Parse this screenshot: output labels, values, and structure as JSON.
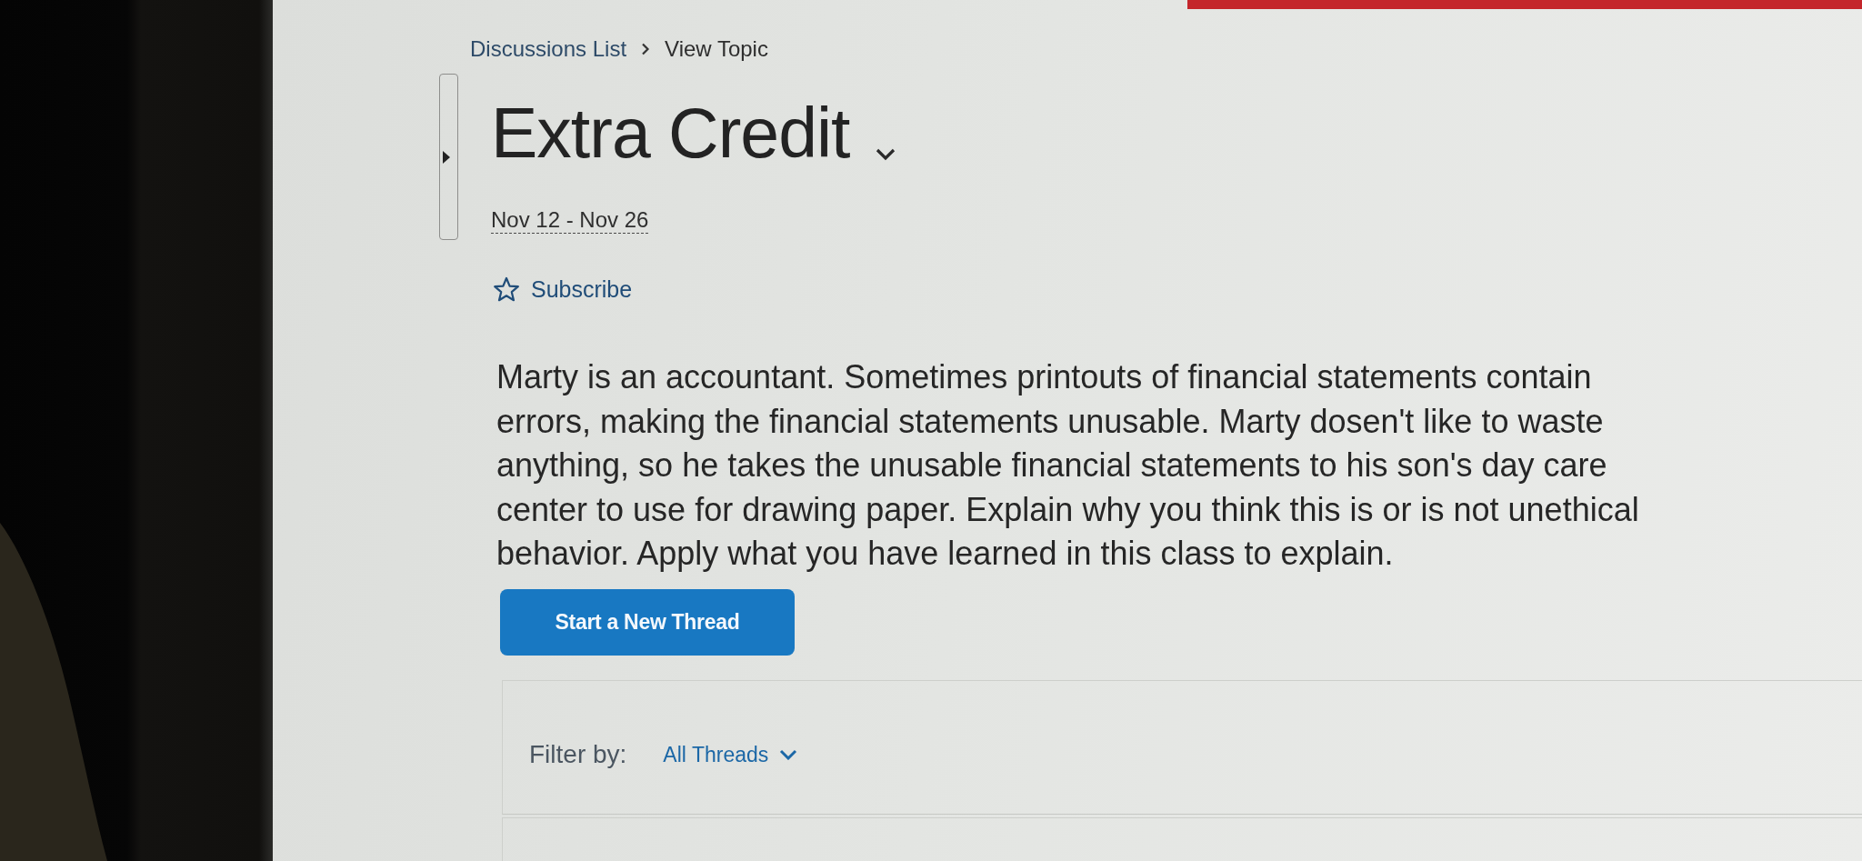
{
  "breadcrumb": [
    {
      "label": "Discussions List",
      "kind": "link"
    },
    {
      "label": "View Topic",
      "kind": "current"
    }
  ],
  "topic": {
    "title": "Extra Credit",
    "dates": "Nov 12 - Nov 26",
    "subscribe": {
      "label": "Subscribe",
      "subscribed": false
    }
  },
  "description": "Marty is an accountant. Sometimes printouts of financial statements contain errors, making the financial statements unusable. Marty dosen't like to waste anything, so he takes the unusable financial statements to his son's day care center to use for drawing paper. Explain why you think this is or is not unethical behavior. Apply what you have learned in this class to explain.",
  "actions": {
    "new_thread": "Start a New Thread"
  },
  "filter": {
    "label": "Filter by:",
    "value": "All Threads"
  }
}
